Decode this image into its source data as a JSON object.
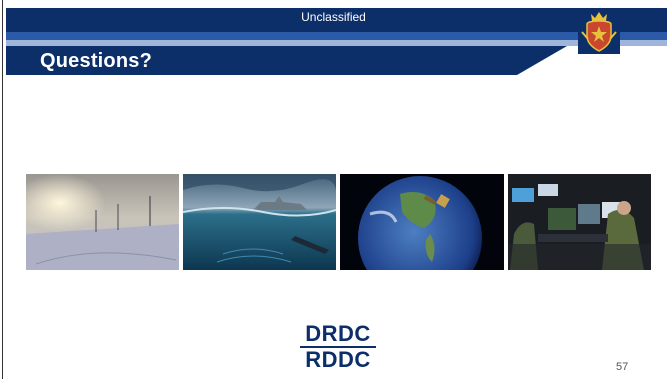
{
  "classification": "Unclassified",
  "title": "Questions?",
  "photos": [
    {
      "name": "arctic-snowfield-photo"
    },
    {
      "name": "ship-and-submarine-photo"
    },
    {
      "name": "earth-satellite-photo"
    },
    {
      "name": "operations-center-photo"
    }
  ],
  "logo": {
    "line1": "DRDC",
    "line2": "RDDC"
  },
  "page_number": "57",
  "colors": {
    "navy": "#0c2f6a",
    "mid_blue": "#2a5aa8",
    "light_blue": "#9fb5da",
    "white": "#ffffff"
  }
}
